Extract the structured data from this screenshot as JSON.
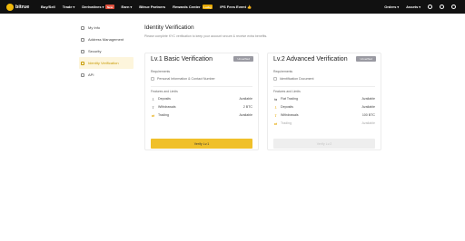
{
  "header": {
    "logo_text": "bitrue",
    "nav": [
      {
        "label": "Buy/Sell"
      },
      {
        "label": "Trade",
        "chevron": true
      },
      {
        "label": "Derivatives",
        "chevron": true,
        "badge": "New"
      },
      {
        "label": "Earn",
        "chevron": true
      },
      {
        "label": "Bitrue Partners"
      },
      {
        "label": "Rewards Center",
        "badge": "Lucky"
      },
      {
        "label": "IPS Fees Event 👍"
      }
    ],
    "right": {
      "orders": "Orders",
      "assets": "Assets"
    }
  },
  "sidebar": {
    "items": [
      {
        "label": "My Info"
      },
      {
        "label": "Address Management"
      },
      {
        "label": "Security"
      },
      {
        "label": "Identity Verification"
      },
      {
        "label": "API"
      }
    ],
    "active_index": 3
  },
  "page": {
    "title": "Identity Verification",
    "subtitle": "Please complete KYC verification to keep your account secure & receive extra benefits."
  },
  "cards": [
    {
      "title": "Lv.1 Basic Verification",
      "status": "Unverified",
      "requirements_label": "Requirements",
      "requirements": [
        "Personal Information & Contact Number"
      ],
      "features_label": "Features and Limits",
      "features": [
        {
          "label": "Deposits",
          "value": "Available",
          "icon": "deposit-icon"
        },
        {
          "label": "Withdrawals",
          "value": "2 BTC",
          "icon": "withdraw-icon"
        },
        {
          "label": "Trading",
          "value": "Available",
          "icon": "trading-icon"
        }
      ],
      "button": "Verify Lv.1"
    },
    {
      "title": "Lv.2 Advanced Verification",
      "status": "Unverified",
      "requirements_label": "Requirements",
      "requirements": [
        "Identification Document"
      ],
      "features_label": "Features and Limits",
      "features": [
        {
          "label": "Fiat Trading",
          "value": "Available",
          "icon": "fiat-icon"
        },
        {
          "label": "Deposits",
          "value": "Available",
          "icon": "deposit-icon"
        },
        {
          "label": "Withdrawals",
          "value": "100 BTC",
          "icon": "withdraw-icon"
        },
        {
          "label": "Trading",
          "value": "Available",
          "icon": "trading-icon"
        }
      ],
      "button": "Verify Lv.2"
    }
  ]
}
